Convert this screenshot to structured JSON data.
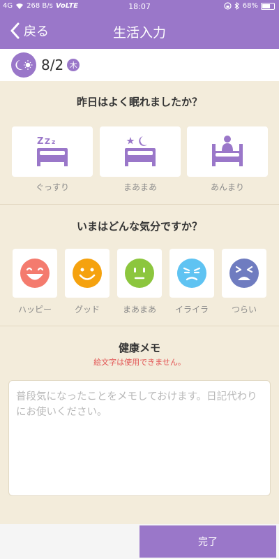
{
  "status_bar": {
    "signal": "4G",
    "speed": "268 B/s",
    "network": "VoLTE",
    "time": "18:07",
    "battery": "68%"
  },
  "header": {
    "back_label": "戻る",
    "title": "生活入力"
  },
  "date_bar": {
    "date": "8/2",
    "weekday": "木"
  },
  "sleep": {
    "question": "昨日はよく眠れましたか？",
    "options": [
      {
        "label": "ぐっすり",
        "icon": "bed-zzz-icon"
      },
      {
        "label": "まあまあ",
        "icon": "bed-moon-icon"
      },
      {
        "label": "あんまり",
        "icon": "bed-person-sitting-icon"
      }
    ]
  },
  "mood": {
    "question": "いまはどんな気分ですか？",
    "options": [
      {
        "label": "ハッピー",
        "icon": "happy-face-icon",
        "color": "#f47b6e"
      },
      {
        "label": "グッド",
        "icon": "smile-face-icon",
        "color": "#f5a20f"
      },
      {
        "label": "まあまあ",
        "icon": "neutral-face-icon",
        "color": "#8cc63e"
      },
      {
        "label": "イライラ",
        "icon": "annoyed-face-icon",
        "color": "#5fc3f2"
      },
      {
        "label": "つらい",
        "icon": "painful-face-icon",
        "color": "#6f7cc0"
      }
    ]
  },
  "memo": {
    "title": "健康メモ",
    "warning": "絵文字は使用できません。",
    "placeholder": "普段気になったことをメモしておけます。日記代わりにお使いください。",
    "value": ""
  },
  "footer": {
    "done_label": "完了"
  },
  "colors": {
    "accent": "#9a77c9",
    "background": "#f3ecdb",
    "warning": "#e25252"
  }
}
